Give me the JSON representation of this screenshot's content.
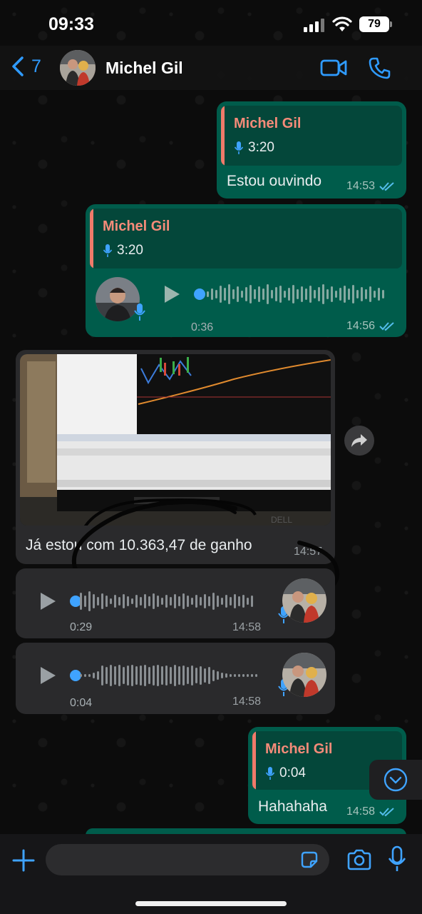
{
  "status_bar": {
    "time": "09:33",
    "battery": "79"
  },
  "header": {
    "back_count": "7",
    "contact_name": "Michel Gil"
  },
  "messages": [
    {
      "quote_name": "Michel Gil",
      "quote_duration": "3:20",
      "text": "Estou ouvindo",
      "time": "14:53"
    },
    {
      "quote_name": "Michel Gil",
      "quote_duration": "3:20",
      "voice_duration": "0:36",
      "time": "14:56"
    },
    {
      "caption": "Já estou com 10.363,47 de ganho",
      "time": "14:57",
      "image_overlay": "DELL"
    },
    {
      "voice_duration": "0:29",
      "time": "14:58"
    },
    {
      "voice_duration": "0:04",
      "time": "14:58"
    },
    {
      "quote_name": "Michel Gil",
      "quote_duration": "0:04",
      "text": "Hahahaha",
      "time": "14:58"
    }
  ],
  "colors": {
    "accent": "#2f9bff",
    "outgoing_bubble": "#005c4b",
    "incoming_bubble": "#2a2a2c",
    "quote_name": "#f58b79"
  },
  "icons": [
    "back-chevron-icon",
    "video-call-icon",
    "phone-icon",
    "microphone-icon",
    "play-icon",
    "forward-icon",
    "chevron-down-icon",
    "plus-icon",
    "sticker-icon",
    "camera-icon",
    "double-check-icon"
  ]
}
